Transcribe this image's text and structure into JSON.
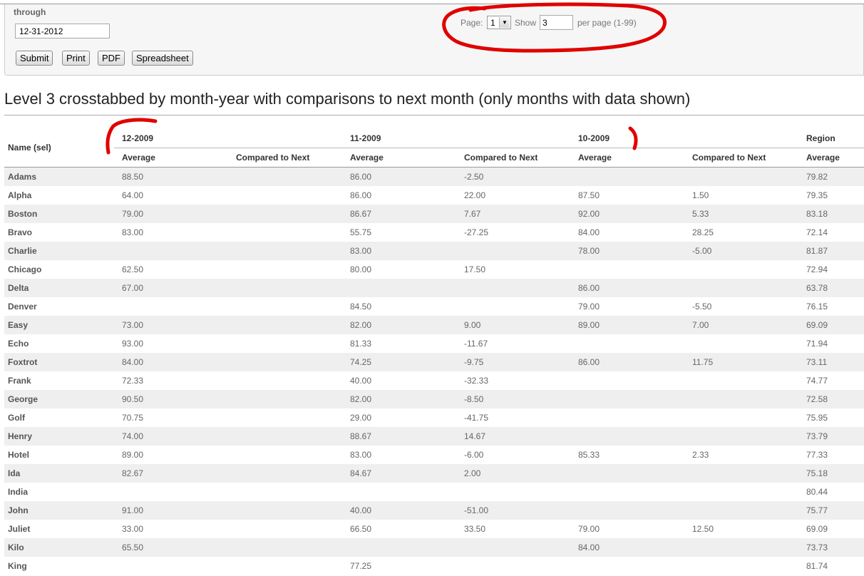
{
  "filters": {
    "through_label": "through",
    "through_value": "12-31-2012",
    "buttons": {
      "submit": "Submit",
      "print": "Print",
      "pdf": "PDF",
      "spreadsheet": "Spreadsheet"
    }
  },
  "pager": {
    "page_label": "Page:",
    "page_value": "1",
    "show_label": "Show",
    "show_value": "3",
    "per_page_label": "per page (1-99)"
  },
  "report": {
    "title": "Level 3 crosstabbed by month-year with comparisons to next month (only months with data shown)",
    "name_header": "Name (sel)",
    "groups": [
      "12-2009",
      "11-2009",
      "10-2009",
      "Region"
    ],
    "subheaders": [
      "Average",
      "Compared to Next",
      "Average",
      "Compared to Next",
      "Average",
      "Compared to Next",
      "Average"
    ],
    "rows": [
      {
        "name": "Adams",
        "v": [
          "88.50",
          "",
          "86.00",
          "-2.50",
          "",
          "",
          "79.82"
        ]
      },
      {
        "name": "Alpha",
        "v": [
          "64.00",
          "",
          "86.00",
          "22.00",
          "87.50",
          "1.50",
          "79.35"
        ]
      },
      {
        "name": "Boston",
        "v": [
          "79.00",
          "",
          "86.67",
          "7.67",
          "92.00",
          "5.33",
          "83.18"
        ]
      },
      {
        "name": "Bravo",
        "v": [
          "83.00",
          "",
          "55.75",
          "-27.25",
          "84.00",
          "28.25",
          "72.14"
        ]
      },
      {
        "name": "Charlie",
        "v": [
          "",
          "",
          "83.00",
          "",
          "78.00",
          "-5.00",
          "81.87"
        ]
      },
      {
        "name": "Chicago",
        "v": [
          "62.50",
          "",
          "80.00",
          "17.50",
          "",
          "",
          "72.94"
        ]
      },
      {
        "name": "Delta",
        "v": [
          "67.00",
          "",
          "",
          "",
          "86.00",
          "",
          "63.78"
        ]
      },
      {
        "name": "Denver",
        "v": [
          "",
          "",
          "84.50",
          "",
          "79.00",
          "-5.50",
          "76.15"
        ]
      },
      {
        "name": "Easy",
        "v": [
          "73.00",
          "",
          "82.00",
          "9.00",
          "89.00",
          "7.00",
          "69.09"
        ]
      },
      {
        "name": "Echo",
        "v": [
          "93.00",
          "",
          "81.33",
          "-11.67",
          "",
          "",
          "71.94"
        ]
      },
      {
        "name": "Foxtrot",
        "v": [
          "84.00",
          "",
          "74.25",
          "-9.75",
          "86.00",
          "11.75",
          "73.11"
        ]
      },
      {
        "name": "Frank",
        "v": [
          "72.33",
          "",
          "40.00",
          "-32.33",
          "",
          "",
          "74.77"
        ]
      },
      {
        "name": "George",
        "v": [
          "90.50",
          "",
          "82.00",
          "-8.50",
          "",
          "",
          "72.58"
        ]
      },
      {
        "name": "Golf",
        "v": [
          "70.75",
          "",
          "29.00",
          "-41.75",
          "",
          "",
          "75.95"
        ]
      },
      {
        "name": "Henry",
        "v": [
          "74.00",
          "",
          "88.67",
          "14.67",
          "",
          "",
          "73.79"
        ]
      },
      {
        "name": "Hotel",
        "v": [
          "89.00",
          "",
          "83.00",
          "-6.00",
          "85.33",
          "2.33",
          "77.33"
        ]
      },
      {
        "name": "Ida",
        "v": [
          "82.67",
          "",
          "84.67",
          "2.00",
          "",
          "",
          "75.18"
        ]
      },
      {
        "name": "India",
        "v": [
          "",
          "",
          "",
          "",
          "",
          "",
          "80.44"
        ]
      },
      {
        "name": "John",
        "v": [
          "91.00",
          "",
          "40.00",
          "-51.00",
          "",
          "",
          "75.77"
        ]
      },
      {
        "name": "Juliet",
        "v": [
          "33.00",
          "",
          "66.50",
          "33.50",
          "79.00",
          "12.50",
          "69.09"
        ]
      },
      {
        "name": "Kilo",
        "v": [
          "65.50",
          "",
          "",
          "",
          "84.00",
          "",
          "73.73"
        ]
      },
      {
        "name": "King",
        "v": [
          "",
          "",
          "77.25",
          "",
          "",
          "",
          "81.74"
        ]
      }
    ]
  },
  "colors": {
    "annotation": "#e00000",
    "stripe": "#efefef"
  }
}
